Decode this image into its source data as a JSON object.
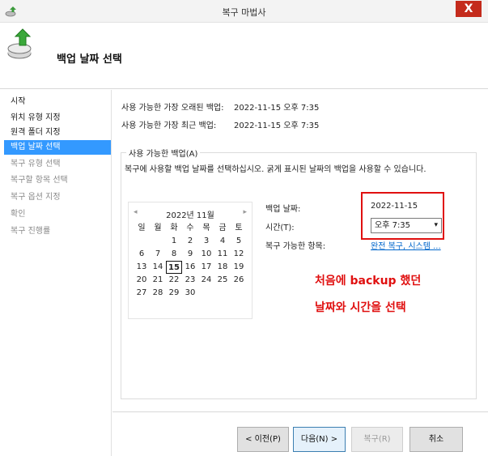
{
  "window": {
    "title": "복구 마법사",
    "close_label": "X",
    "accent": "#c42b1c"
  },
  "header": {
    "title": "백업 날짜 선택",
    "icon": "backup-restore-icon"
  },
  "nav": {
    "items": [
      {
        "label": "시작",
        "state": "normal"
      },
      {
        "label": "위치 유형 지정",
        "state": "normal"
      },
      {
        "label": "원격 폴더 지정",
        "state": "normal"
      },
      {
        "label": "백업 날짜 선택",
        "state": "active"
      },
      {
        "label": "복구 유형 선택",
        "state": "disabled"
      },
      {
        "label": "복구할 항목 선택",
        "state": "disabled"
      },
      {
        "label": "복구 옵션 지정",
        "state": "disabled"
      },
      {
        "label": "확인",
        "state": "disabled"
      },
      {
        "label": "복구 진행률",
        "state": "disabled"
      }
    ]
  },
  "info": {
    "oldest_label": "사용 가능한 가장 오래된 백업:",
    "oldest_value": "2022-11-15 오후 7:35",
    "latest_label": "사용 가능한 가장 최근 백업:",
    "latest_value": "2022-11-15 오후 7:35"
  },
  "available": {
    "legend": "사용 가능한 백업(A)",
    "description": "복구에 사용할 백업 날짜를 선택하십시오. 굵게 표시된 날짜의 백업을 사용할 수 있습니다."
  },
  "calendar": {
    "prev": "◂",
    "next": "▸",
    "title": "2022년 11월",
    "weekdays": [
      "일",
      "월",
      "화",
      "수",
      "목",
      "금",
      "토"
    ],
    "weeks": [
      [
        "",
        "",
        "1",
        "2",
        "3",
        "4",
        "5"
      ],
      [
        "6",
        "7",
        "8",
        "9",
        "10",
        "11",
        "12"
      ],
      [
        "13",
        "14",
        "15",
        "16",
        "17",
        "18",
        "19"
      ],
      [
        "20",
        "21",
        "22",
        "23",
        "24",
        "25",
        "26"
      ],
      [
        "27",
        "28",
        "29",
        "30",
        "",
        "",
        ""
      ]
    ],
    "selected_day": "15"
  },
  "details": {
    "date_label": "백업 날짜:",
    "date_value": "2022-11-15",
    "time_label": "시간(T):",
    "time_value": "오후 7:35",
    "items_label": "복구 가능한 항목:",
    "items_link": "완전 복구, 시스템 ..."
  },
  "annotation": {
    "line1": "처음에 backup 했던",
    "line2": "날짜와 시간을 선택",
    "color": "#e01010"
  },
  "buttons": {
    "prev": "< 이전(P)",
    "next": "다음(N) >",
    "recover": "복구(R)",
    "cancel": "취소"
  }
}
